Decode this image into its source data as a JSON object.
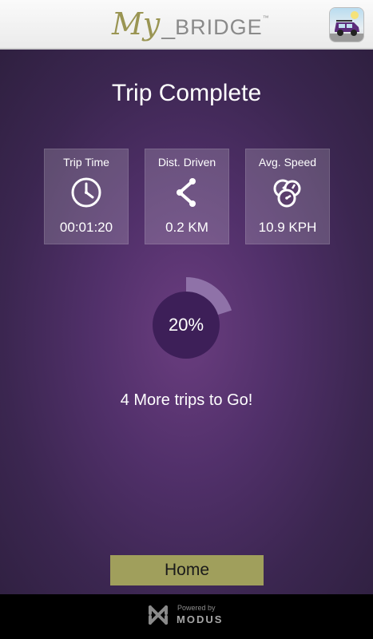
{
  "header": {
    "logo_my": "My",
    "logo_sep": "_",
    "logo_bridge": "BRIDGE",
    "logo_tm": "™",
    "app_icon": "car-icon"
  },
  "main": {
    "title": "Trip Complete",
    "stats": [
      {
        "label": "Trip Time",
        "value": "00:01:20",
        "icon": "clock-icon"
      },
      {
        "label": "Dist. Driven",
        "value": "0.2 KM",
        "icon": "route-icon"
      },
      {
        "label": "Avg. Speed",
        "value": "10.9 KPH",
        "icon": "speedometer-icon"
      }
    ],
    "progress": {
      "percent_text": "20%",
      "fraction": 0.2
    },
    "trips_remaining": "4 More trips to Go!",
    "home_label": "Home"
  },
  "footer": {
    "powered_by": "Powered by",
    "brand": "MODUS",
    "logo_icon": "modus-logo-icon"
  },
  "colors": {
    "header_bg": "#f2f2f2",
    "main_bg": "#51306a",
    "button_bg": "#a09f5c",
    "progress_fill": "#8f72a8",
    "progress_center": "#3d1f58"
  }
}
